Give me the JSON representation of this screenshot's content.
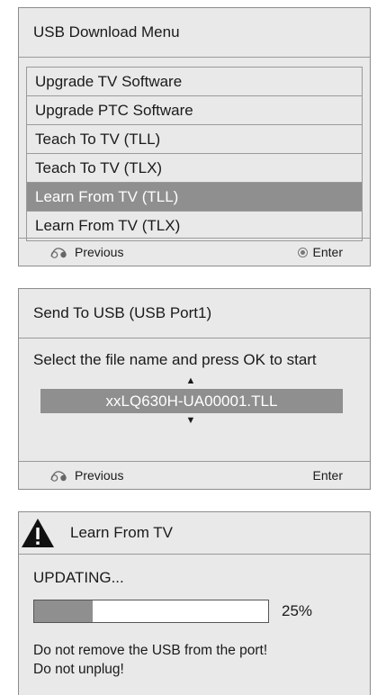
{
  "download_menu": {
    "title": "USB Download Menu",
    "items": [
      {
        "label": "Upgrade TV Software"
      },
      {
        "label": "Upgrade PTC Software"
      },
      {
        "label": "Teach To TV (TLL)"
      },
      {
        "label": "Teach To TV (TLX)"
      },
      {
        "label": "Learn From TV (TLL)",
        "selected": true
      },
      {
        "label": "Learn From TV (TLX)"
      }
    ],
    "footer": {
      "previous_label": "Previous",
      "enter_label": "Enter"
    }
  },
  "send_dialog": {
    "title": "Send To USB (USB Port1)",
    "instruction": "Select the file name and press OK to start",
    "up_arrow": "▲",
    "down_arrow": "▼",
    "selected_file": "xxLQ630H-UA00001.TLL",
    "footer": {
      "previous_label": "Previous",
      "enter_label": "Enter"
    }
  },
  "progress_dialog": {
    "title": "Learn From TV",
    "status": "UPDATING...",
    "progress_percent": 25,
    "progress_label": "25%",
    "warning_line1": "Do not remove the USB from the port!",
    "warning_line2": "Do not unplug!"
  },
  "icons": {
    "previous": "back-remote-icon",
    "enter": "ok-button-icon",
    "warning": "warning-icon"
  },
  "colors": {
    "panel_bg": "#e9e9e9",
    "selected_bg": "#8f8f8f",
    "border": "#9a9a9a"
  }
}
